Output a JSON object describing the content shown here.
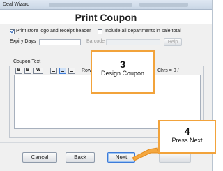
{
  "window": {
    "title": "Deal Wizard"
  },
  "page": {
    "heading": "Print Coupon"
  },
  "options": {
    "print_logo": {
      "label": "Print store logo and receipt header",
      "checked": true
    },
    "include_all_departments": {
      "label": "Include all departments in sale total",
      "checked": false
    }
  },
  "expiry": {
    "label": "Expiry Days",
    "value": ""
  },
  "barcode": {
    "label": "Barcode",
    "value": "",
    "help_label": "Help"
  },
  "coupon_text": {
    "label": "Coupon Text",
    "toolbar": {
      "bold": "B",
      "italic": "B",
      "wide": "W"
    },
    "row_label": "Row",
    "chars_label": "Chrs = 0 /",
    "value": ""
  },
  "buttons": {
    "cancel": "Cancel",
    "back": "Back",
    "next": "Next"
  },
  "callouts": [
    {
      "number": "3",
      "text": "Design Coupon"
    },
    {
      "number": "4",
      "text": "Press Next"
    }
  ],
  "colors": {
    "callout_border": "#f2a33b",
    "callout_arrow": "#f4a73f",
    "focus_accent": "#3d7bd9"
  }
}
